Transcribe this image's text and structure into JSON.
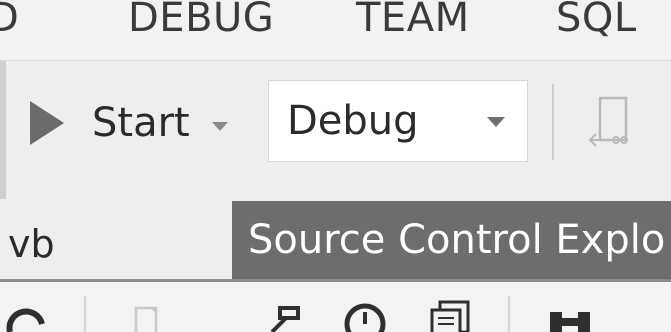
{
  "menu": {
    "items": [
      {
        "label": "D"
      },
      {
        "label": "DEBUG"
      },
      {
        "label": "TEAM"
      },
      {
        "label": "SQL"
      }
    ]
  },
  "toolbar": {
    "start_label": "Start",
    "play_icon": "play-icon",
    "start_dropdown_icon": "chevron-down-icon",
    "configuration": {
      "value": "Debug",
      "dropdown_icon": "chevron-down-icon"
    },
    "attach_icon": "attach-to-process-icon"
  },
  "tabs": {
    "inactive_label": "vb",
    "active_label": "Source Control Explo"
  },
  "lower_toolbar": {
    "icons": [
      "refresh-icon",
      "new-item-icon",
      "connect-icon",
      "history-icon",
      "copy-icon",
      "navigation-icon"
    ]
  },
  "colors": {
    "active_tab_bg": "#6d6d6d",
    "active_tab_text": "#ffffff",
    "play_icon": "#6b6b6b",
    "toolbar_bg": "#eeeeee"
  }
}
